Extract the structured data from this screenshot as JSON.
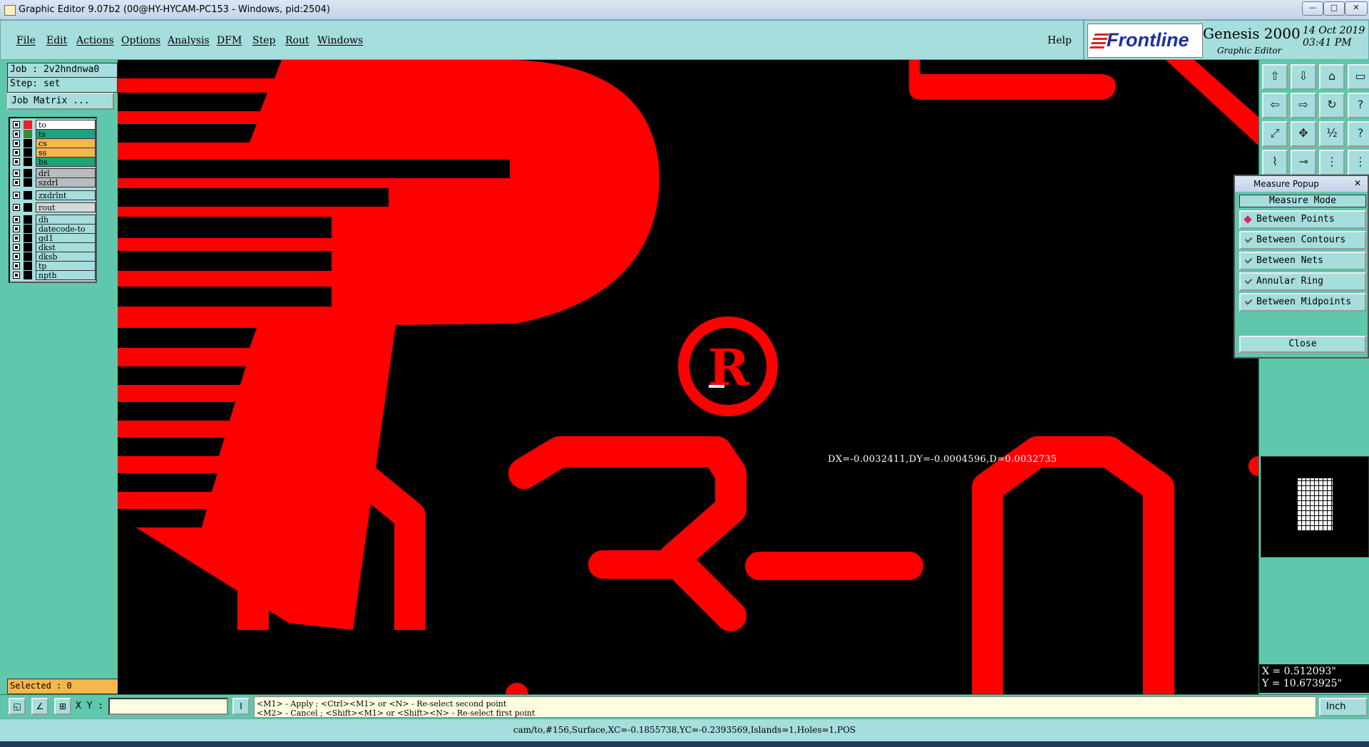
{
  "window": {
    "title": "Graphic Editor 9.07b2 (00@HY-HYCAM-PC153 - Windows, pid:2504)",
    "minimize_glyph": "—",
    "maximize_glyph": "□",
    "close_glyph": "✕"
  },
  "menu": {
    "items": [
      "File",
      "Edit",
      "Actions",
      "Options",
      "Analysis",
      "DFM",
      "Step",
      "Rout",
      "Windows"
    ],
    "help": "Help"
  },
  "logo": {
    "brand": "Frontline",
    "product": "Genesis 2000",
    "subtitle": "Graphic Editor",
    "date": "14 Oct 2019",
    "time": "03:41 PM"
  },
  "left_panel": {
    "job": "Job : 2v2hndnwa0",
    "step": "Step: set",
    "job_matrix": "Job Matrix ...",
    "layers": [
      {
        "name": "to",
        "color": "#ffffff",
        "swatch": "#e8202a"
      },
      {
        "name": "ts",
        "color": "#1aa57a",
        "swatch": "#3a8a3a"
      },
      {
        "name": "cs",
        "color": "#f5b64a",
        "swatch": "#000000"
      },
      {
        "name": "ss",
        "color": "#f5b64a",
        "swatch": "#000000"
      },
      {
        "name": "bs",
        "color": "#1aa57a",
        "swatch": "#000000"
      },
      {
        "name": "drl",
        "color": "#b8bcc0",
        "swatch": "#000000"
      },
      {
        "name": "szdrl",
        "color": "#b8bcc0",
        "swatch": "#000000"
      },
      {
        "name": "zxdrlnt",
        "color": "#a6dddd",
        "swatch": "#000000"
      },
      {
        "name": "rout",
        "color": "#d8d8d8",
        "swatch": "#000000"
      },
      {
        "name": "dh",
        "color": "#a6dddd",
        "swatch": "#000000"
      },
      {
        "name": "datecode-to",
        "color": "#a6dddd",
        "swatch": "#000000"
      },
      {
        "name": "gd1",
        "color": "#a6dddd",
        "swatch": "#000000"
      },
      {
        "name": "dkst",
        "color": "#a6dddd",
        "swatch": "#000000"
      },
      {
        "name": "dksb",
        "color": "#a6dddd",
        "swatch": "#000000"
      },
      {
        "name": "tp",
        "color": "#a6dddd",
        "swatch": "#000000"
      },
      {
        "name": "npth",
        "color": "#a6dddd",
        "swatch": "#000000"
      }
    ],
    "selected": "Selected : 0"
  },
  "canvas": {
    "measure_readout": "DX=-0.0032411,DY=-0.0004596,D=0.0032735",
    "feature_color": "#ff0000",
    "background_color": "#000000"
  },
  "toolbar_icons": [
    "zoom-in-icon",
    "zoom-out-icon",
    "home-icon",
    "window-icon",
    "pan-left-icon",
    "pan-right-icon",
    "redraw-icon",
    "script-icon",
    "fit-screen-icon",
    "fit-profile-icon",
    "scale-1-2-icon",
    "help-icon",
    "measure-icon",
    "snap-icon",
    "nets-icon",
    "graphic-icon"
  ],
  "measure_popup": {
    "title": "Measure Popup",
    "close_glyph": "✕",
    "mode_header": "Measure Mode",
    "options": [
      {
        "label": "Between Points",
        "selected": true
      },
      {
        "label": "Between Contours",
        "selected": false
      },
      {
        "label": "Between Nets",
        "selected": false
      },
      {
        "label": "Annular Ring",
        "selected": false
      },
      {
        "label": "Between Midpoints",
        "selected": false
      }
    ],
    "close_label": "Close"
  },
  "coords": {
    "x": "X = 0.512093\"",
    "y": "Y = 10.673925\""
  },
  "bottom": {
    "xy_label": "X Y :",
    "message_line1": "<M1> - Apply  ; <Ctrl><M1> or <N> - Re-select second point",
    "message_line2": "<M2> - Cancel ; <Shift><M1> or <Shift><N> - Re-select first point",
    "unit": "Inch"
  },
  "status": "cam/to,#156,Surface,XC=-0.1855738,YC=-0.2393569,Islands=1,Holes=1,POS"
}
